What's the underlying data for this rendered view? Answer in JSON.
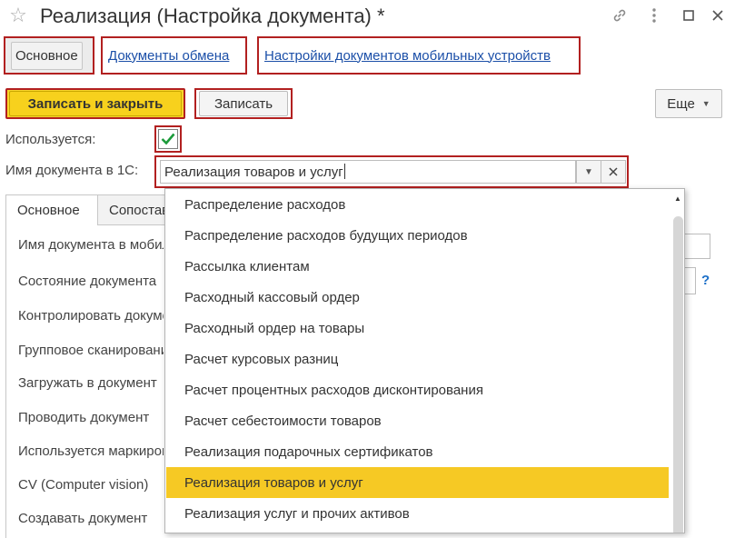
{
  "window": {
    "title": "Реализация (Настройка документа) *",
    "icons": [
      "star-icon",
      "link-icon",
      "more-vertical-icon",
      "maximize-icon",
      "close-icon"
    ]
  },
  "form_tabs": [
    {
      "label": "Основное"
    },
    {
      "label": "Документы обмена"
    },
    {
      "label": "Настройки документов мобильных устройств"
    }
  ],
  "toolbar": {
    "save_close_label": "Записать и закрыть",
    "save_label": "Записать",
    "more_label": "Еще"
  },
  "fields": {
    "used_label": "Используется:",
    "used_checked": true,
    "doc_name_label": "Имя документа в 1С:",
    "doc_name_value": "Реализация товаров и услуг"
  },
  "inner_tabs": [
    {
      "label": "Основное"
    },
    {
      "label": "Сопоставление"
    }
  ],
  "panel_rows": [
    "Имя документа в мобильном устройстве",
    "Состояние документа",
    "Контролировать документ",
    "Групповое сканирование",
    "Загружать в документ",
    "Проводить документ",
    "Используется маркировка",
    "CV (Computer vision)",
    "Создавать документ"
  ],
  "help_mark": "?",
  "dropdown": {
    "items": [
      "Распределение расходов",
      "Распределение расходов будущих периодов",
      "Рассылка клиентам",
      "Расходный кассовый ордер",
      "Расходный ордер на товары",
      "Расчет курсовых разниц",
      "Расчет процентных расходов дисконтирования",
      "Расчет себестоимости товаров",
      "Реализация подарочных сертификатов",
      "Реализация товаров и услуг",
      "Реализация услуг и прочих активов"
    ],
    "selected_index": 9
  },
  "colors": {
    "accent_yellow": "#f7d11d",
    "highlight_border": "#b22020",
    "selected_row": "#f6c924",
    "link": "#1b4fa8",
    "check": "#1c9b3a"
  }
}
